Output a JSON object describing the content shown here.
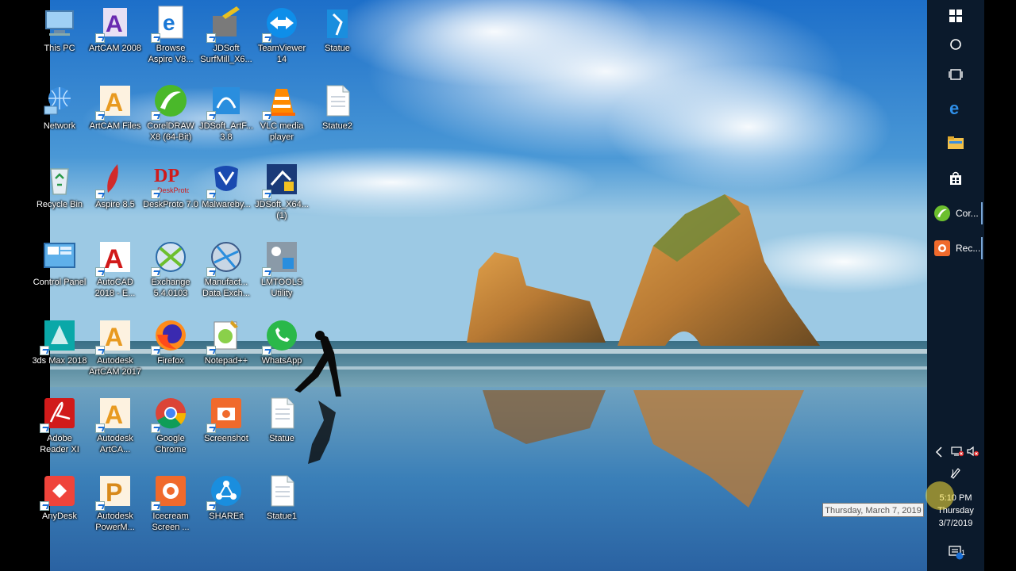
{
  "desktop": {
    "icons": [
      {
        "label": "This PC",
        "icon": "this-pc-icon"
      },
      {
        "label": "ArtCAM 2008",
        "icon": "artcam-2008-icon"
      },
      {
        "label": "Browse Aspire V8...",
        "icon": "edge-browser-icon"
      },
      {
        "label": "JDSoft SurfMill_X6...",
        "icon": "jdsoft-surfmill-icon"
      },
      {
        "label": "TeamViewer 14",
        "icon": "teamviewer-icon"
      },
      {
        "label": "Statue",
        "icon": "statue-app-icon"
      },
      {
        "label": "Network",
        "icon": "network-icon"
      },
      {
        "label": "ArtCAM Files",
        "icon": "artcam-files-icon"
      },
      {
        "label": "CorelDRAW X8 (64-Bit)",
        "icon": "coreldraw-icon"
      },
      {
        "label": "JDSoft_ArtF... 3.8",
        "icon": "jdsoft-artform-icon"
      },
      {
        "label": "VLC media player",
        "icon": "vlc-icon"
      },
      {
        "label": "Statue2",
        "icon": "document-icon"
      },
      {
        "label": "Recycle Bin",
        "icon": "recycle-bin-icon"
      },
      {
        "label": "Aspire 8.5",
        "icon": "aspire-icon"
      },
      {
        "label": "DeskProto 7.0",
        "icon": "deskproto-icon"
      },
      {
        "label": "Malwareby...",
        "icon": "malwarebytes-icon"
      },
      {
        "label": "JDSoft_X64... (1)",
        "icon": "jdsoft-x64-icon"
      },
      {
        "label": "Control Panel",
        "icon": "control-panel-icon"
      },
      {
        "label": "AutoCAD 2018 - E...",
        "icon": "autocad-icon"
      },
      {
        "label": "Exchange 5.4.0103",
        "icon": "exchange-icon"
      },
      {
        "label": "Manufact... Data Exch...",
        "icon": "manufacturing-data-exchange-icon"
      },
      {
        "label": "LMTOOLS Utility",
        "icon": "lmtools-icon"
      },
      {
        "label": "3ds Max 2018",
        "icon": "3ds-max-icon"
      },
      {
        "label": "Autodesk ArtCAM 2017",
        "icon": "artcam-2017-icon"
      },
      {
        "label": "Firefox",
        "icon": "firefox-icon"
      },
      {
        "label": "Notepad++",
        "icon": "notepad-plus-plus-icon"
      },
      {
        "label": "WhatsApp",
        "icon": "whatsapp-icon"
      },
      {
        "label": "Adobe Reader XI",
        "icon": "adobe-reader-icon"
      },
      {
        "label": "Autodesk ArtCA...",
        "icon": "autodesk-artcam-icon"
      },
      {
        "label": "Google Chrome",
        "icon": "chrome-icon"
      },
      {
        "label": "Screenshot",
        "icon": "screenshot-icon"
      },
      {
        "label": "Statue",
        "icon": "document-icon"
      },
      {
        "label": "AnyDesk",
        "icon": "anydesk-icon"
      },
      {
        "label": "Autodesk PowerM...",
        "icon": "powermill-icon"
      },
      {
        "label": "Icecream Screen ...",
        "icon": "icecream-screen-icon"
      },
      {
        "label": "SHAREit",
        "icon": "shareit-icon"
      },
      {
        "label": "Statue1",
        "icon": "document-icon"
      }
    ]
  },
  "taskbar": {
    "start": "windows-start-icon",
    "search": "cortana-search-icon",
    "task_view": "task-view-icon",
    "pinned": [
      "edge-icon",
      "file-explorer-icon",
      "store-icon"
    ],
    "apps": [
      {
        "label": "Cor...",
        "icon": "coreldraw-icon"
      },
      {
        "label": "Rec...",
        "icon": "icecream-recorder-icon"
      }
    ],
    "tray": {
      "chevron": "chevron-left-icon",
      "network": "network-disconnected-icon",
      "volume": "volume-muted-icon",
      "pen": "pen-icon"
    },
    "clock": {
      "time": "5:10 PM",
      "day": "Thursday",
      "date": "3/7/2019"
    },
    "notifications": {
      "icon": "action-center-icon",
      "count": "1"
    }
  },
  "tooltip": {
    "text": "Thursday, March 7, 2019"
  },
  "colors": {
    "taskbar": "#0b1a2c",
    "accent": "#1a6fd6"
  }
}
